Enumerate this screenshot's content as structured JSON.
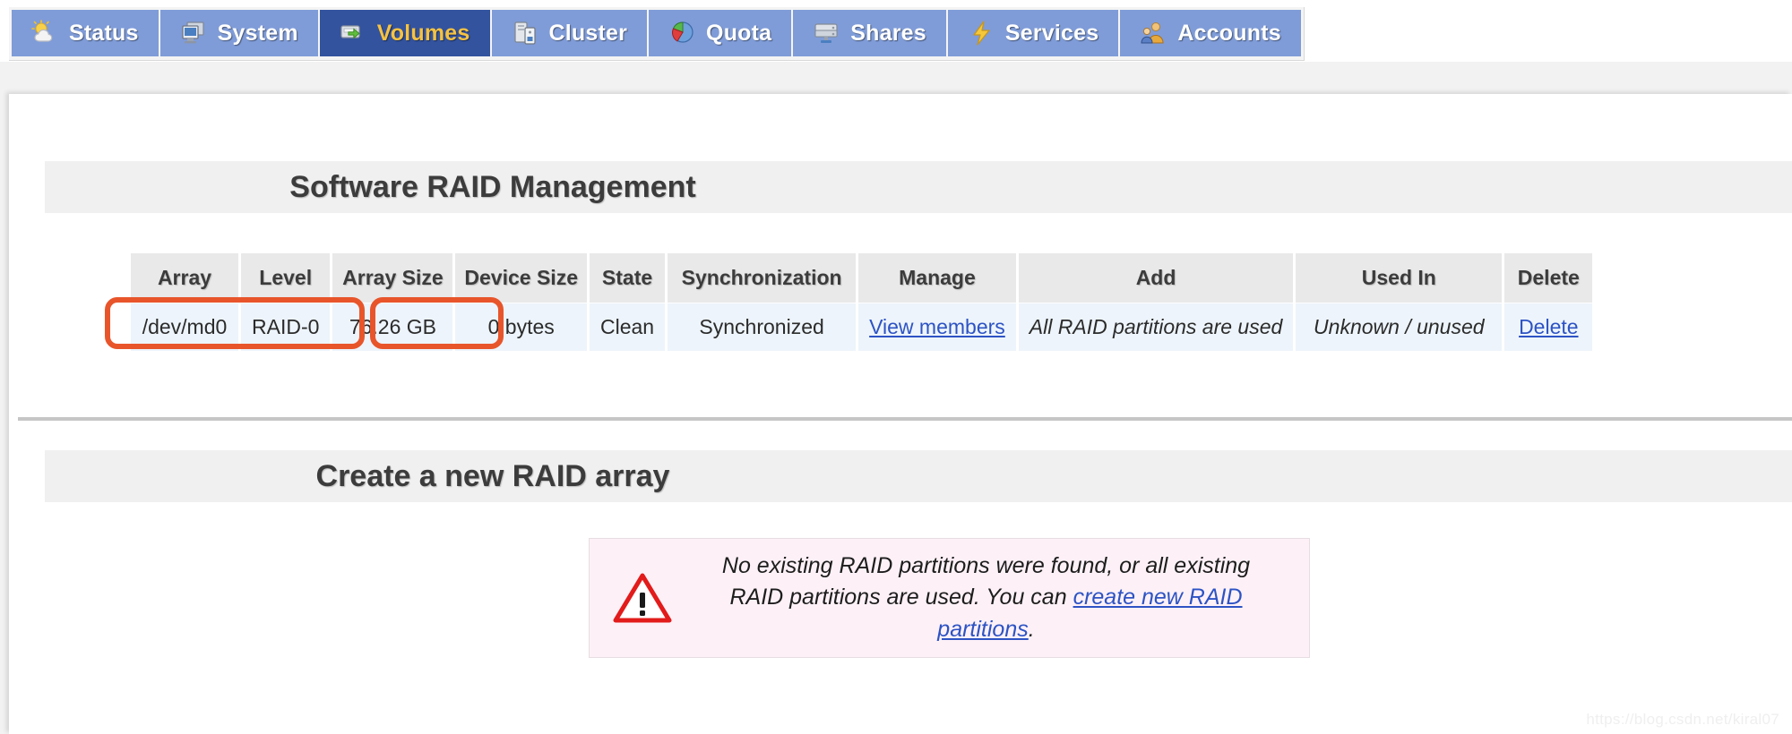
{
  "nav": {
    "tabs": [
      {
        "label": "Status",
        "icon": "sun-cloud-icon",
        "active": false
      },
      {
        "label": "System",
        "icon": "monitor-icon",
        "active": false
      },
      {
        "label": "Volumes",
        "icon": "disk-arrow-icon",
        "active": true
      },
      {
        "label": "Cluster",
        "icon": "servers-icon",
        "active": false
      },
      {
        "label": "Quota",
        "icon": "pie-chart-icon",
        "active": false
      },
      {
        "label": "Shares",
        "icon": "drive-icon",
        "active": false
      },
      {
        "label": "Services",
        "icon": "lightning-icon",
        "active": false
      },
      {
        "label": "Accounts",
        "icon": "users-icon",
        "active": false
      }
    ]
  },
  "sections": {
    "raid_management_title": "Software RAID Management",
    "create_array_title": "Create a new RAID array"
  },
  "raid_table": {
    "columns": [
      "Array",
      "Level",
      "Array Size",
      "Device Size",
      "State",
      "Synchronization",
      "Manage",
      "Add",
      "Used In",
      "Delete"
    ],
    "rows": [
      {
        "array": "/dev/md0",
        "level": "RAID-0",
        "array_size": "76.26 GB",
        "device_size": "0 bytes",
        "state": "Clean",
        "synchronization": "Synchronized",
        "manage": "View members",
        "add": "All RAID partitions are used",
        "used_in": "Unknown / unused",
        "delete": "Delete"
      }
    ]
  },
  "warning": {
    "icon": "warning-triangle-icon",
    "text_before": "No existing RAID partitions were found, or all existing RAID partitions are used. You can ",
    "link_text": "create new RAID partitions",
    "text_after": "."
  },
  "watermark": "https://blog.csdn.net/kiral07",
  "colors": {
    "tab_inactive": "#7f9cd8",
    "tab_active": "#33539e",
    "tab_active_text": "#f5c242",
    "highlight_orange": "#e8552b",
    "row_background": "#edf4fb",
    "header_background": "#e9e9e9",
    "link_blue": "#2d53c4",
    "warning_background": "#fdf1f7"
  }
}
